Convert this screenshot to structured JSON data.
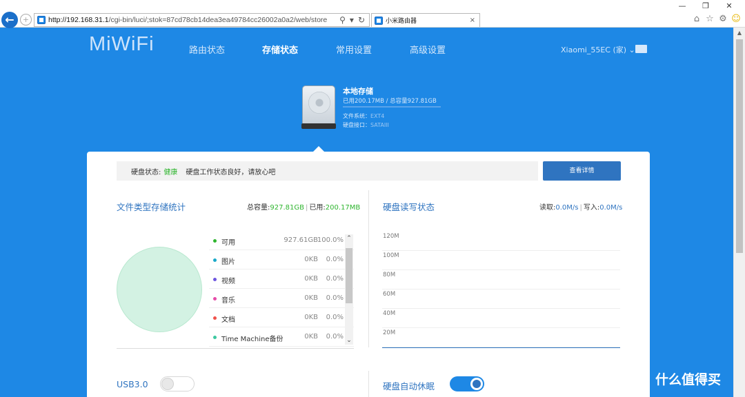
{
  "browser": {
    "url_host": "http://192.168.31.1",
    "url_path": "/cgi-bin/luci/;stok=87cd78cb14dea3ea49784cc26002a0a2/web/store",
    "tab_title": "小米路由器",
    "tab_close": "×",
    "back": "←",
    "forward": "+",
    "win_minimize": "—",
    "win_restore": "❐",
    "win_close": "✕",
    "search_glyph": "⚲",
    "dropdown_glyph": "▾",
    "refresh_glyph": "↻",
    "home_glyph": "⌂",
    "star_glyph": "☆",
    "gear_glyph": "⚙",
    "smile_glyph": "☺"
  },
  "app": {
    "logo": "MiWiFi",
    "nav": [
      "路由状态",
      "存储状态",
      "常用设置",
      "高级设置"
    ],
    "active_nav": 1,
    "router_name": "Xiaomi_55EC (家)",
    "router_chevron": "⌄"
  },
  "disk": {
    "title": "本地存储",
    "usage": "已用200.17MB / 总容量927.81GB",
    "usage_fraction": 0.0002,
    "fs_label": "文件系统：",
    "fs_value": "EXT4",
    "if_label": "硬盘接口：",
    "if_value": "SATAIII"
  },
  "status": {
    "label": "硬盘状态:",
    "value": "健康",
    "message": "硬盘工作状态良好，请放心吧",
    "detail_button": "查看详情"
  },
  "storage_stats": {
    "title": "文件类型存储统计",
    "total_label": "总容量:",
    "total_value": "927.81GB",
    "sep": "|",
    "used_label": "已用:",
    "used_value": "200.17MB",
    "items": [
      {
        "name": "可用",
        "size": "927.61GB",
        "pct": "100.0%",
        "color": "#2fb52f"
      },
      {
        "name": "图片",
        "size": "0KB",
        "pct": "0.0%",
        "color": "#1aa9c9"
      },
      {
        "name": "视频",
        "size": "0KB",
        "pct": "0.0%",
        "color": "#6e56e0"
      },
      {
        "name": "音乐",
        "size": "0KB",
        "pct": "0.0%",
        "color": "#e64ca8"
      },
      {
        "name": "文档",
        "size": "0KB",
        "pct": "0.0%",
        "color": "#f0524c"
      },
      {
        "name": "Time Machine备份",
        "size": "0KB",
        "pct": "0.0%",
        "color": "#3cc8a0"
      }
    ],
    "scroll_up": "⌃",
    "scroll_down": "⌄"
  },
  "io": {
    "title": "硬盘读写状态",
    "read_label": "读取:",
    "read_value": "0.0M/s",
    "sep": "|",
    "write_label": "写入:",
    "write_value": "0.0M/s",
    "y_labels": [
      "120M",
      "100M",
      "80M",
      "60M",
      "40M",
      "20M"
    ]
  },
  "settings": {
    "usb_label": "USB3.0",
    "usb_on": false,
    "sleep_label": "硬盘自动休眠",
    "sleep_on": true
  },
  "watermark": {
    "logo": "值",
    "text": "什么值得买"
  }
}
